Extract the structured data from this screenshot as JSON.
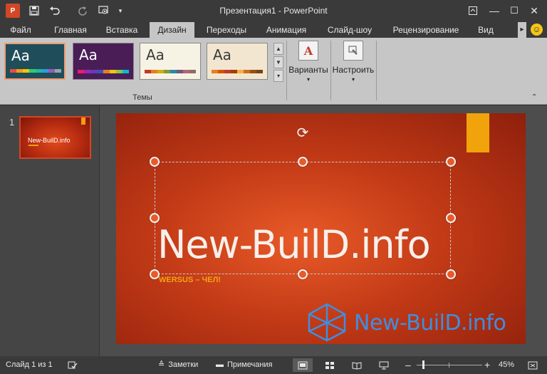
{
  "window": {
    "title": "Презентация1 - PowerPoint",
    "app_icon_label": "P",
    "controls": {
      "ribbon_options_icon": "ribbon-display-icon",
      "minimize": "—",
      "maximize": "☐",
      "close": "✕"
    }
  },
  "quick_access": {
    "save_icon": "save-icon",
    "undo_icon": "undo-icon",
    "redo_icon": "redo-icon",
    "start_from_beginning_icon": "present-icon",
    "customize_icon": "customize-qat-icon"
  },
  "tabs": [
    {
      "label": "Файл",
      "active": false
    },
    {
      "label": "Главная",
      "active": false
    },
    {
      "label": "Вставка",
      "active": false
    },
    {
      "label": "Дизайн",
      "active": true
    },
    {
      "label": "Переходы",
      "active": false
    },
    {
      "label": "Анимация",
      "active": false
    },
    {
      "label": "Слайд-шоу",
      "active": false
    },
    {
      "label": "Рецензирование",
      "active": false
    },
    {
      "label": "Вид",
      "active": false
    }
  ],
  "ribbon": {
    "themes_group_label": "Темы",
    "themes": [
      {
        "sample": "Aa",
        "bg": "#1f4e5a",
        "fg": "#ffffff",
        "swatches": [
          "#e84c3d",
          "#f39c12",
          "#f1c40f",
          "#2ecc71",
          "#1abc9c",
          "#3498db",
          "#9b59b6",
          "#95a5a6"
        ]
      },
      {
        "sample": "Aa",
        "bg": "#4b1d57",
        "fg": "#ffffff",
        "swatches": [
          "#e91e63",
          "#9c27b0",
          "#673ab7",
          "#3f51b5",
          "#e67e22",
          "#f1c40f",
          "#8bc34a",
          "#00bcd4"
        ]
      },
      {
        "sample": "Aa",
        "bg": "#f7f3e4",
        "fg": "#3b3b3b",
        "swatches": [
          "#c0392b",
          "#e67e22",
          "#d4ac0d",
          "#7d9b3b",
          "#2e86ab",
          "#6c5b7b",
          "#b56576",
          "#8d6e63"
        ]
      },
      {
        "sample": "Aa",
        "bg": "#f2e6d0",
        "fg": "#3b3b3b",
        "swatches": [
          "#e67e22",
          "#d35400",
          "#c0392b",
          "#a04000",
          "#f5b041",
          "#ca6f1e",
          "#935116",
          "#784212"
        ]
      }
    ],
    "variants_label": "Варианты",
    "customize_label": "Настроить"
  },
  "slides_pane": {
    "slide_number": "1",
    "thumbnail_title": "New-BuilD.info"
  },
  "slide": {
    "title": "New-BuilD.info",
    "subtitle": "WERSUS – ЧЕЛ!",
    "watermark_text": "New-BuilD.info"
  },
  "statusbar": {
    "slide_counter": "Слайд 1 из 1",
    "notes_label": "Заметки",
    "comments_label": "Примечания",
    "zoom_minus": "–",
    "zoom_plus": "+",
    "zoom_level": "45%"
  },
  "colors": {
    "accent": "#d24726",
    "slide_orange": "#f0a30a",
    "watermark_blue": "#3d8fe0"
  }
}
